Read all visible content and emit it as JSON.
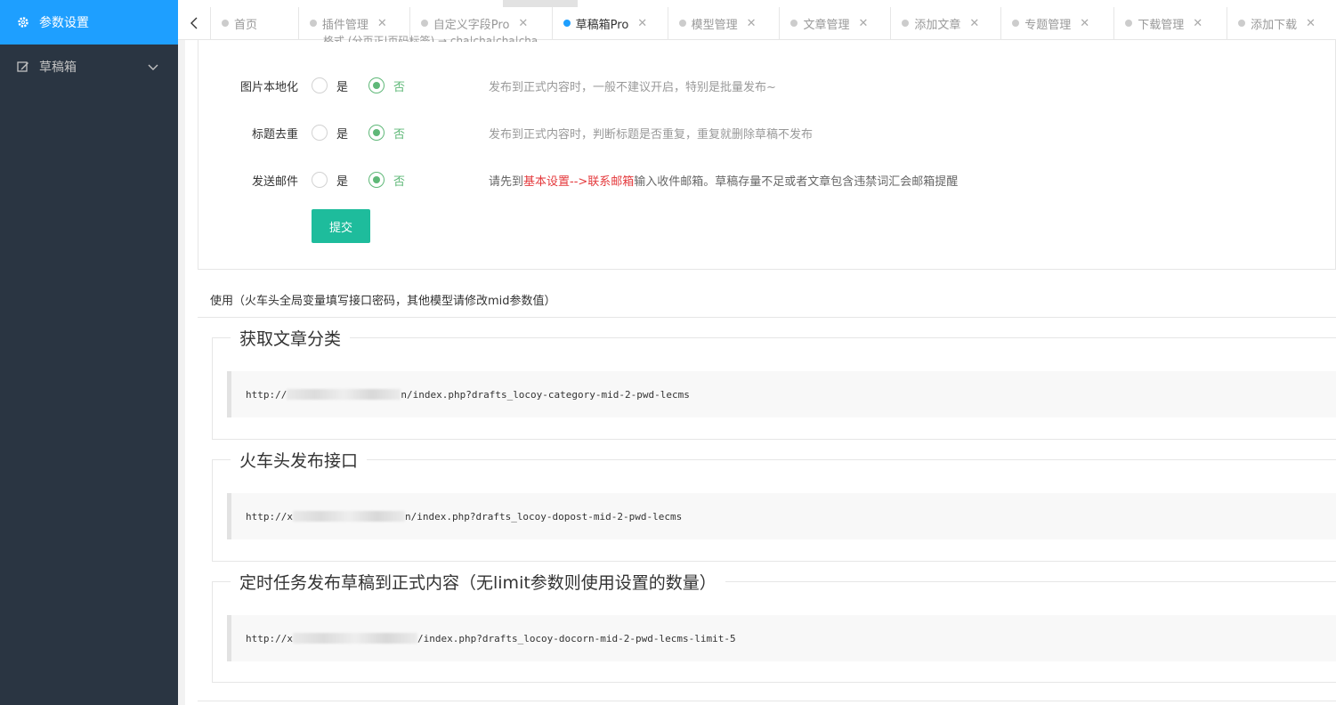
{
  "sidebar": {
    "items": [
      {
        "label": "参数设置",
        "icon": "gear-icon"
      },
      {
        "label": "草稿箱",
        "icon": "edit-icon"
      }
    ]
  },
  "tabs": [
    {
      "label": "首页",
      "closable": false
    },
    {
      "label": "插件管理",
      "closable": true
    },
    {
      "label": "自定义字段Pro",
      "closable": true
    },
    {
      "label": "草稿箱Pro",
      "closable": true,
      "active": true
    },
    {
      "label": "模型管理",
      "closable": true
    },
    {
      "label": "文章管理",
      "closable": true
    },
    {
      "label": "添加文章",
      "closable": true
    },
    {
      "label": "专题管理",
      "closable": true
    },
    {
      "label": "下载管理",
      "closable": true
    },
    {
      "label": "添加下载",
      "closable": true
    }
  ],
  "form": {
    "partial_text": "格式 (分页正|页码标签) → cha|cha|cha|cha",
    "rows": [
      {
        "label": "图片本地化",
        "yes": "是",
        "no": "否",
        "hint": "发布到正式内容时，一般不建议开启，特别是批量发布~"
      },
      {
        "label": "标题去重",
        "yes": "是",
        "no": "否",
        "hint": "发布到正式内容时，判断标题是否重复，重复就删除草稿不发布"
      },
      {
        "label": "发送邮件",
        "yes": "是",
        "no": "否",
        "hint_prefix": "请先到",
        "hint_link": "基本设置-->联系邮箱",
        "hint_suffix": "输入收件邮箱。草稿存量不足或者文章包含违禁词汇会邮箱提醒"
      }
    ],
    "submit_label": "提交"
  },
  "usage": {
    "title": "使用（火车头全局变量填写接口密码，其他模型请修改mid参数值）",
    "sections": [
      {
        "legend": "获取文章分类",
        "url_prefix": "http://",
        "url_suffix": "n/index.php?drafts_locoy-category-mid-2-pwd-lecms"
      },
      {
        "legend": "火车头发布接口",
        "url_prefix": "http://x",
        "url_suffix": "n/index.php?drafts_locoy-dopost-mid-2-pwd-lecms"
      },
      {
        "legend": "定时任务发布草稿到正式内容（无limit参数则使用设置的数量）",
        "url_prefix": "http://x",
        "url_suffix": "/index.php?drafts_locoy-docorn-mid-2-pwd-lecms-limit-5"
      }
    ]
  },
  "colors": {
    "sidebar_bg": "#2a3542",
    "active_blue": "#1e9fff",
    "radio_green": "#5fb878",
    "button_teal": "#1ebc9c",
    "link_red": "#e4393c"
  }
}
